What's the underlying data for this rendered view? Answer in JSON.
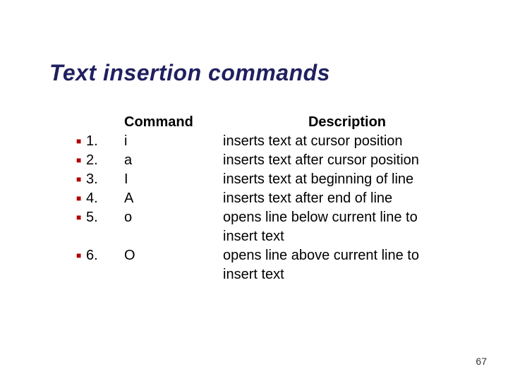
{
  "title": "Text insertion commands",
  "headers": {
    "command": "Command",
    "description": "Description"
  },
  "rows": [
    {
      "num": "1.",
      "cmd": "i",
      "desc": "inserts text at cursor position"
    },
    {
      "num": "2.",
      "cmd": "a",
      "desc": "inserts text after cursor position"
    },
    {
      "num": "3.",
      "cmd": "I",
      "desc": "inserts text at beginning of line"
    },
    {
      "num": "4.",
      "cmd": "A",
      "desc": "inserts text after end of line"
    },
    {
      "num": "5.",
      "cmd": "o",
      "desc": "opens line below current line to insert text"
    },
    {
      "num": "6.",
      "cmd": "O",
      "desc": "opens line above current line to insert text"
    }
  ],
  "page_number": "67"
}
